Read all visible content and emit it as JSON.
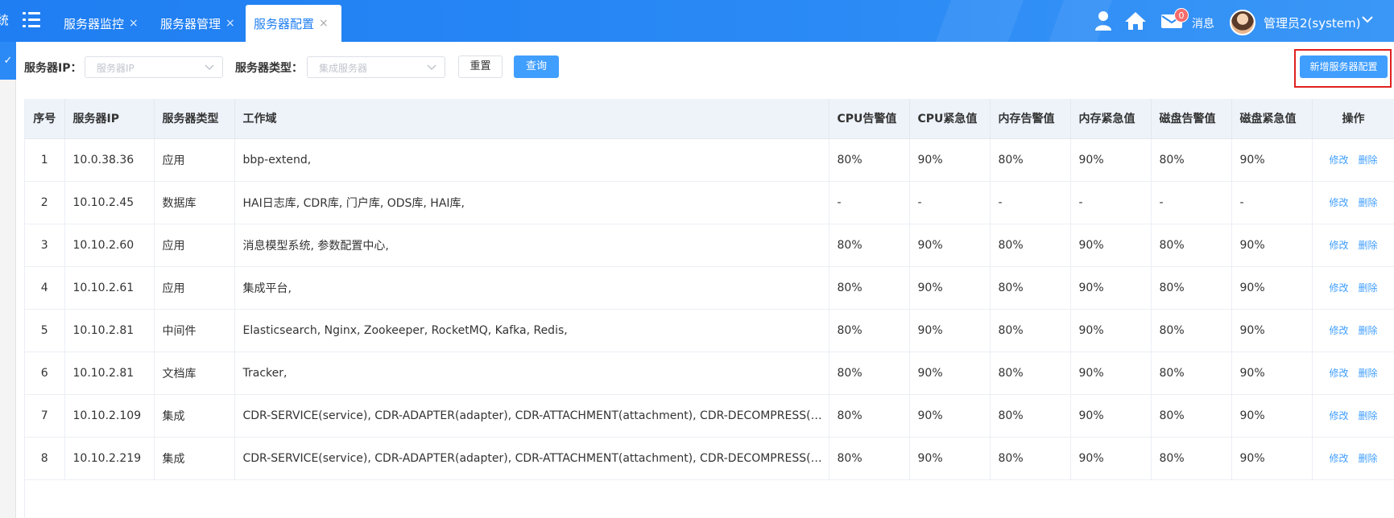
{
  "header": {
    "system_char": "统",
    "tabs": [
      {
        "label": "服务器监控",
        "close": "×"
      },
      {
        "label": "服务器管理",
        "close": "×"
      },
      {
        "label": "服务器配置",
        "close": "×",
        "active": true
      }
    ],
    "message_badge": "0",
    "message_label": "消息",
    "user_name": "管理员2(system)",
    "icons": [
      "menu-icon",
      "user-icon",
      "home-icon",
      "mail-icon",
      "avatar",
      "chevron-down-icon"
    ],
    "accent_color": "#1f7ef2"
  },
  "sidebar": {
    "selected_mark": "✓"
  },
  "search": {
    "ip_label": "服务器IP：",
    "ip_placeholder": "服务器IP",
    "type_label": "服务器类型：",
    "type_placeholder": "集成服务器",
    "reset_label": "重置",
    "query_label": "查询",
    "add_label": "新增服务器配置"
  },
  "table": {
    "columns": [
      "序号",
      "服务器IP",
      "服务器类型",
      "工作域",
      "CPU告警值",
      "CPU紧急值",
      "内存告警值",
      "内存紧急值",
      "磁盘告警值",
      "磁盘紧急值",
      "操作"
    ],
    "edit_label": "修改",
    "delete_label": "删除",
    "rows": [
      [
        "1",
        "10.0.38.36",
        "应用",
        "bbp-extend,",
        "80%",
        "90%",
        "80%",
        "90%",
        "80%",
        "90%"
      ],
      [
        "2",
        "10.10.2.45",
        "数据库",
        "HAI日志库, CDR库, 门户库, ODS库, HAI库,",
        "-",
        "-",
        "-",
        "-",
        "-",
        "-"
      ],
      [
        "3",
        "10.10.2.60",
        "应用",
        "消息模型系统, 参数配置中心,",
        "80%",
        "90%",
        "80%",
        "90%",
        "80%",
        "90%"
      ],
      [
        "4",
        "10.10.2.61",
        "应用",
        "集成平台,",
        "80%",
        "90%",
        "80%",
        "90%",
        "80%",
        "90%"
      ],
      [
        "5",
        "10.10.2.81",
        "中间件",
        "Elasticsearch, Nginx, Zookeeper, RocketMQ, Kafka, Redis,",
        "80%",
        "90%",
        "80%",
        "90%",
        "80%",
        "90%"
      ],
      [
        "6",
        "10.10.2.81",
        "文档库",
        "Tracker,",
        "80%",
        "90%",
        "80%",
        "90%",
        "80%",
        "90%"
      ],
      [
        "7",
        "10.10.2.109",
        "集成",
        "CDR-SERVICE(service), CDR-ADAPTER(adapter), CDR-ATTACHMENT(attachment), CDR-DECOMPRESS(decompre...",
        "80%",
        "90%",
        "80%",
        "90%",
        "80%",
        "90%"
      ],
      [
        "8",
        "10.10.2.219",
        "集成",
        "CDR-SERVICE(service), CDR-ADAPTER(adapter), CDR-ATTACHMENT(attachment), CDR-DECOMPRESS(decompre...",
        "80%",
        "90%",
        "80%",
        "90%",
        "80%",
        "90%"
      ]
    ]
  }
}
